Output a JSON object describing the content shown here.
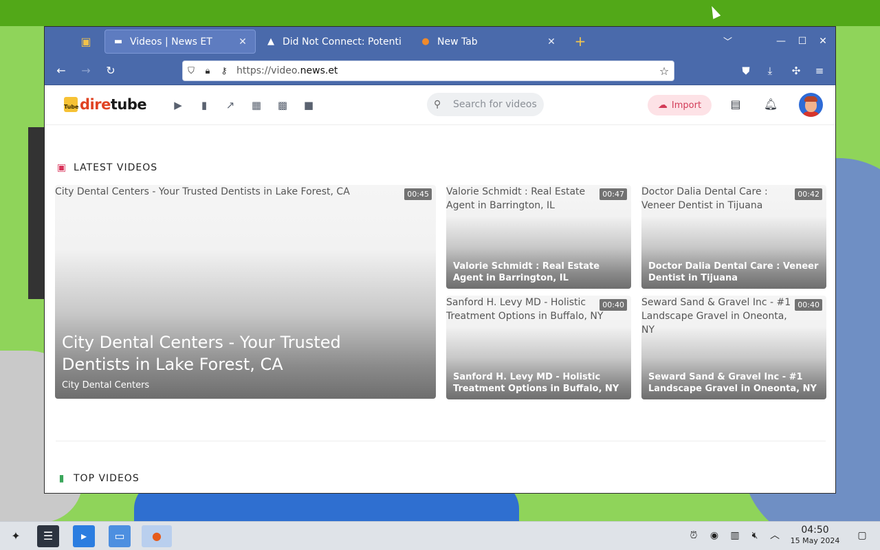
{
  "browser": {
    "tabs": [
      {
        "title": "Videos | News ET",
        "icon": "diretube-favicon",
        "active": true
      },
      {
        "title": "Did Not Connect: Potenti",
        "icon": "warning-icon",
        "active": false
      },
      {
        "title": "New Tab",
        "icon": "firefox-icon",
        "active": false
      }
    ],
    "url_prefix": "https://video.",
    "url_domain": "news.et"
  },
  "site": {
    "logo_small": "Tube",
    "logo_dire": "dire",
    "logo_tube": "tube",
    "search_placeholder": "Search for videos",
    "import_label": "Import",
    "accent": "#d8345a"
  },
  "latest": {
    "title": "LATEST VIDEOS",
    "featured": {
      "alt": "City Dental Centers - Your Trusted Dentists in Lake Forest, CA",
      "duration": "00:45",
      "title": "City Dental Centers - Your Trusted Dentists in Lake Forest, CA",
      "channel": "City Dental Centers"
    },
    "videos": [
      {
        "alt": "Valorie Schmidt : Real Estate Agent in Barrington, IL",
        "duration": "00:47",
        "title": "Valorie Schmidt : Real Estate Agent in Barrington, IL"
      },
      {
        "alt": "Doctor Dalia Dental Care : Veneer Dentist in Tijuana",
        "duration": "00:42",
        "title": "Doctor Dalia Dental Care : Veneer Dentist in Tijuana"
      },
      {
        "alt": "Sanford H. Levy MD - Holistic Treatment Options in Buffalo, NY",
        "duration": "00:40",
        "title": "Sanford H. Levy MD - Holistic Treatment Options in Buffalo, NY"
      },
      {
        "alt": "Seward Sand & Gravel Inc - #1 Landscape Gravel in Oneonta, NY",
        "duration": "00:40",
        "title": "Seward Sand & Gravel Inc - #1 Landscape Gravel in Oneonta, NY"
      }
    ]
  },
  "top": {
    "title": "TOP VIDEOS"
  },
  "taskbar": {
    "time": "04:50",
    "date": "15 May 2024"
  }
}
